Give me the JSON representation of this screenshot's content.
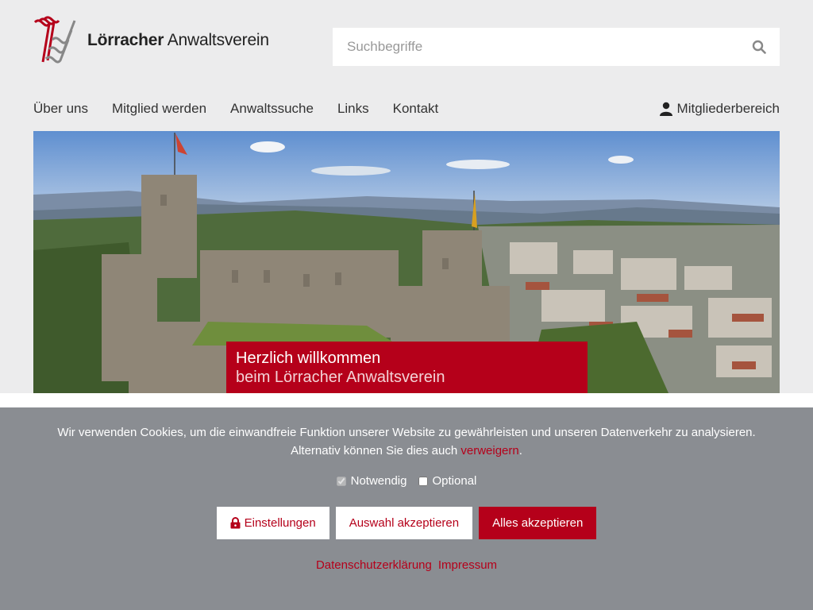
{
  "brand": {
    "name_bold": "Lörracher",
    "name_rest": "Anwaltsverein"
  },
  "search": {
    "placeholder": "Suchbegriffe",
    "icon": "search-icon"
  },
  "nav": {
    "items": [
      {
        "label": "Über uns"
      },
      {
        "label": "Mitglied werden"
      },
      {
        "label": "Anwaltssuche"
      },
      {
        "label": "Links"
      },
      {
        "label": "Kontakt"
      }
    ],
    "members_label": "Mitgliederbereich",
    "members_icon": "user-icon"
  },
  "hero": {
    "title": "Herzlich willkommen",
    "subtitle": "beim Lörracher Anwaltsverein"
  },
  "cookie": {
    "line1": "Wir verwenden Cookies, um die einwandfreie Funktion unserer Website zu gewährleisten und unseren Datenverkehr zu analysieren.",
    "line2_prefix": "Alternativ können Sie dies auch ",
    "refuse_link": "verweigern",
    "line2_suffix": ".",
    "checkboxes": [
      {
        "label": "Notwendig",
        "checked": true,
        "disabled": true
      },
      {
        "label": "Optional",
        "checked": false,
        "disabled": false
      }
    ],
    "buttons": {
      "settings": "Einstellungen",
      "accept_selection": "Auswahl akzeptieren",
      "accept_all": "Alles akzeptieren"
    },
    "links": {
      "privacy": "Datenschutzerklärung",
      "imprint": "Impressum"
    }
  },
  "colors": {
    "accent": "#b5001a",
    "overlay": "#8a8d92",
    "background": "#ececed"
  }
}
